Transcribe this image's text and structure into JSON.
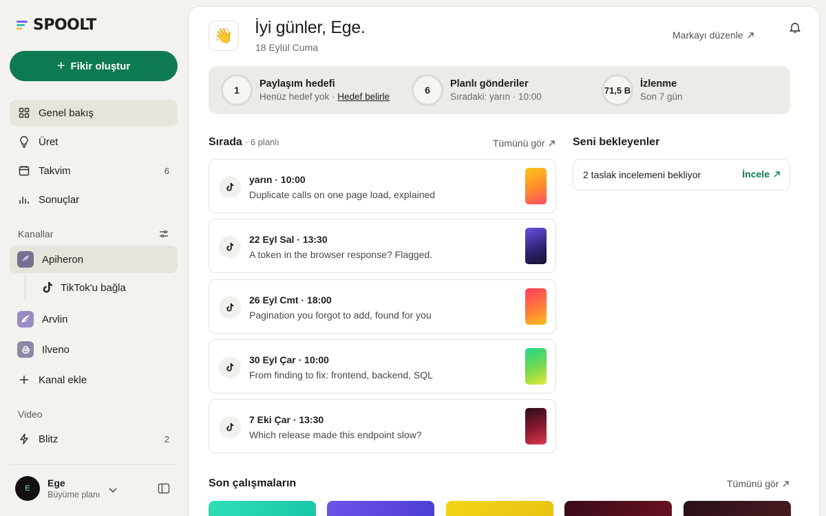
{
  "app": {
    "logo": "SPOOLT",
    "accent": "#0e7a4f"
  },
  "sidebar": {
    "create_button": "Fikir oluştur",
    "nav": [
      {
        "label": "Genel bakış",
        "icon": "grid-icon",
        "active": true
      },
      {
        "label": "Üret",
        "icon": "lightbulb-icon"
      },
      {
        "label": "Takvim",
        "icon": "calendar-icon",
        "count": "6"
      },
      {
        "label": "Sonuçlar",
        "icon": "bar-chart-icon"
      }
    ],
    "channels_label": "Kanallar",
    "channels": [
      {
        "label": "Apiheron",
        "icon": "feather-icon",
        "active": true
      },
      {
        "label": "TikTok'u bağla",
        "icon": "tiktok-icon"
      },
      {
        "label": "Arvlin",
        "icon": "wing-icon"
      },
      {
        "label": "Ilveno",
        "icon": "spiral-icon"
      }
    ],
    "add_channel": "Kanal ekle",
    "video_label": "Video",
    "video": [
      {
        "label": "Blitz",
        "icon": "bolt-icon",
        "count": "2"
      }
    ],
    "user": {
      "initial": "E",
      "name": "Ege",
      "plan": "Büyüme planı"
    }
  },
  "header": {
    "wave": "👋",
    "greeting": "İyi günler, Ege.",
    "date": "18 Eylül Cuma",
    "brand_link": "Markayı düzenle"
  },
  "stats": [
    {
      "ring": "1",
      "title": "Paylaşım hedefi",
      "sub": "Henüz hedef yok · ",
      "link": "Hedef belirle"
    },
    {
      "ring": "6",
      "title": "Planlı gönderiler",
      "sub": "Sıradaki: yarın · 10:00"
    },
    {
      "ring": "71,5 B",
      "title": "İzlenme",
      "sub": "Son 7 gün"
    }
  ],
  "queue": {
    "title": "Sırada",
    "sub": "· 6 planlı",
    "see_all": "Tümünü gör",
    "items": [
      {
        "when": "yarın · 10:00",
        "title": "Duplicate calls on one page load, explained"
      },
      {
        "when": "22 Eyl Sal · 13:30",
        "title": "A token in the browser response? Flagged."
      },
      {
        "when": "26 Eyl Cmt · 18:00",
        "title": "Pagination you forgot to add, found for you"
      },
      {
        "when": "30 Eyl Çar · 10:00",
        "title": "From finding to fix: frontend, backend, SQL"
      },
      {
        "when": "7 Eki Çar · 13:30",
        "title": "Which release made this endpoint slow?"
      }
    ]
  },
  "awaiting": {
    "title": "Seni bekleyenler",
    "text": "2 taslak incelemeni bekliyor",
    "action": "İncele"
  },
  "recent": {
    "title": "Son çalışmaların",
    "see_all": "Tümünü gör"
  }
}
